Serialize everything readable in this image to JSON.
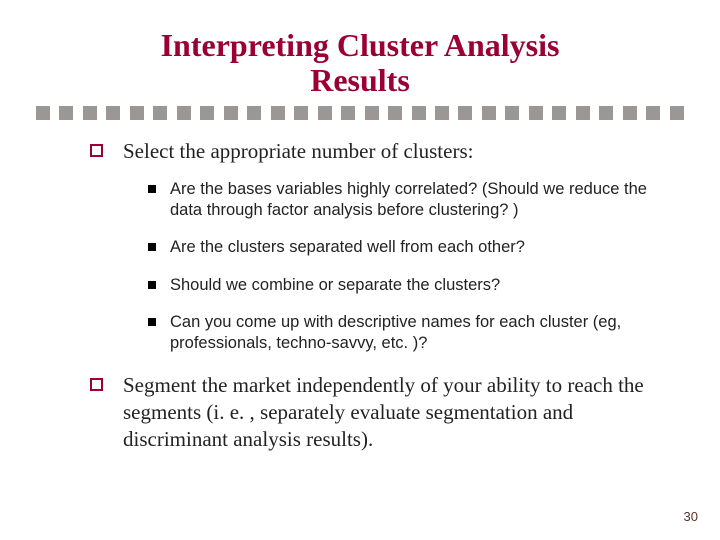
{
  "colors": {
    "accent": "#9a0033",
    "divider": "#9a9794",
    "pagenum": "#5b3326"
  },
  "title_lines": {
    "l1": "Interpreting Cluster Analysis",
    "l2": "Results"
  },
  "bullets": {
    "b1": {
      "text": "Select the appropriate number of clusters:",
      "subs": {
        "s1": "Are the bases variables highly correlated? (Should we reduce the data through factor analysis before clustering? )",
        "s2": "Are the clusters separated well from each other?",
        "s3": "Should we combine or separate the clusters?",
        "s4": "Can you come up with descriptive names for each cluster (eg, professionals, techno-savvy, etc. )?"
      }
    },
    "b2": {
      "text": "Segment the market independently of your ability to reach the segments (i. e. , separately evaluate segmentation and discriminant analysis results)."
    }
  },
  "page_number": "30"
}
